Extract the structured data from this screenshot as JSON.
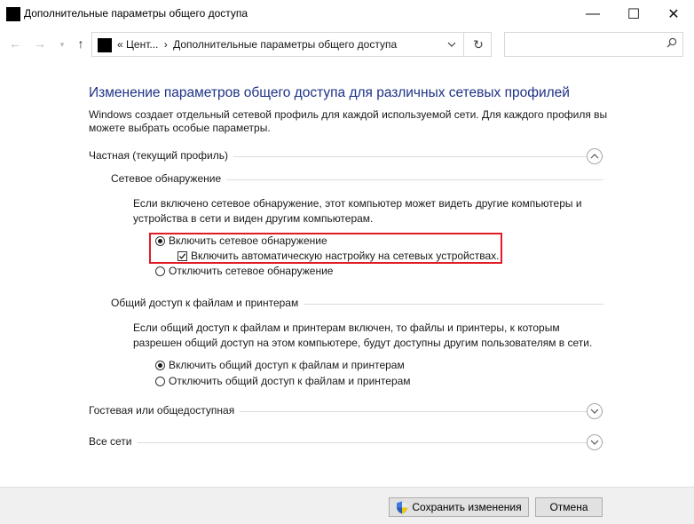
{
  "window": {
    "title": "Дополнительные параметры общего доступа",
    "minimize_glyph": "—",
    "maximize_glyph": "☐",
    "close_glyph": "✕"
  },
  "addressbar": {
    "chevrons": "«",
    "path_part1": "Цент...",
    "separator": "›",
    "path_part2": "Дополнительные параметры общего доступа",
    "search_placeholder": ""
  },
  "main": {
    "heading": "Изменение параметров общего доступа для различных сетевых профилей",
    "description": "Windows создает отдельный сетевой профиль для каждой используемой сети. Для каждого профиля вы можете выбрать особые параметры.",
    "profiles": [
      {
        "label": "Частная (текущий профиль)",
        "expanded": true,
        "sections": [
          {
            "title": "Сетевое обнаружение",
            "text": "Если включено сетевое обнаружение, этот компьютер может видеть другие компьютеры и устройства в сети и виден другим компьютерам.",
            "options": [
              {
                "label": "Включить сетевое обнаружение",
                "checked": true
              },
              {
                "label": "Включить автоматическую настройку на сетевых устройствах.",
                "checked": true
              },
              {
                "label": "Отключить сетевое обнаружение",
                "checked": false
              }
            ]
          },
          {
            "title": "Общий доступ к файлам и принтерам",
            "text": "Если общий доступ к файлам и принтерам включен, то файлы и принтеры, к которым разрешен общий доступ на этом компьютере, будут доступны другим пользователям в сети.",
            "options": [
              {
                "label": "Включить общий доступ к файлам и принтерам",
                "checked": true
              },
              {
                "label": "Отключить общий доступ к файлам и принтерам",
                "checked": false
              }
            ]
          }
        ]
      },
      {
        "label": "Гостевая или общедоступная",
        "expanded": false
      },
      {
        "label": "Все сети",
        "expanded": false
      }
    ]
  },
  "footer": {
    "save_label": "Сохранить изменения",
    "cancel_label": "Отмена"
  },
  "colors": {
    "heading": "#1e3287",
    "highlight_border": "#e01b24",
    "footer_bg": "#f0f0f0"
  }
}
